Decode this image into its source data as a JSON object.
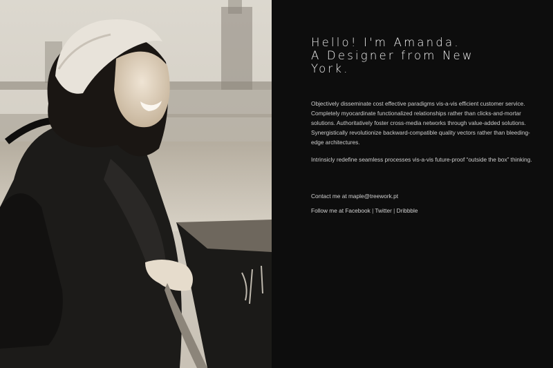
{
  "heading": {
    "line1": "Hello! I'm Amanda.",
    "line2": "A Designer from New",
    "line3": "York."
  },
  "body": {
    "p1": "Objectively disseminate cost effective paradigms vis-a-vis efficient customer service. Completely myocardinate functionalized relationships rather than clicks-and-mortar solutions. Authoritatively foster cross-media networks through value-added solutions. Synergistically revolutionize backward-compatible quality vectors rather than bleeding-edge architectures.",
    "p2": "Intrinsicly redefine seamless processes vis-a-vis future-proof “outside the box” thinking."
  },
  "contact": {
    "prefix": "Contact me at ",
    "email": "maple@treework.pt"
  },
  "follow": {
    "prefix": "Follow me at ",
    "links": [
      "Facebook",
      "Twitter",
      "Dribbble"
    ],
    "separator": " | "
  },
  "colors": {
    "panel_background": "#0d0d0d",
    "text": "#e8e8e8"
  }
}
